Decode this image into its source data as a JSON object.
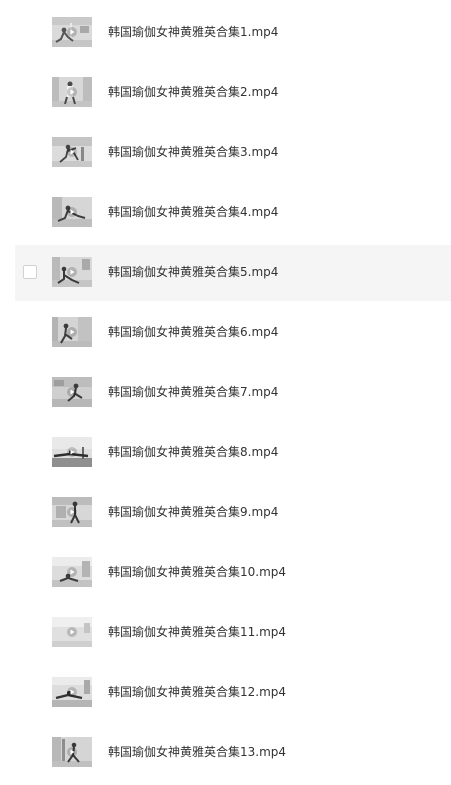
{
  "file_list": {
    "items": [
      {
        "name": "韩国瑜伽女神黄雅英合集1.mp4",
        "icon": "video-thumbnail"
      },
      {
        "name": "韩国瑜伽女神黄雅英合集2.mp4",
        "icon": "video-thumbnail"
      },
      {
        "name": "韩国瑜伽女神黄雅英合集3.mp4",
        "icon": "video-thumbnail"
      },
      {
        "name": "韩国瑜伽女神黄雅英合集4.mp4",
        "icon": "video-thumbnail"
      },
      {
        "name": "韩国瑜伽女神黄雅英合集5.mp4",
        "icon": "video-thumbnail",
        "hovered": true
      },
      {
        "name": "韩国瑜伽女神黄雅英合集6.mp4",
        "icon": "video-thumbnail"
      },
      {
        "name": "韩国瑜伽女神黄雅英合集7.mp4",
        "icon": "video-thumbnail"
      },
      {
        "name": "韩国瑜伽女神黄雅英合集8.mp4",
        "icon": "video-thumbnail"
      },
      {
        "name": "韩国瑜伽女神黄雅英合集9.mp4",
        "icon": "video-thumbnail"
      },
      {
        "name": "韩国瑜伽女神黄雅英合集10.mp4",
        "icon": "video-thumbnail"
      },
      {
        "name": "韩国瑜伽女神黄雅英合集11.mp4",
        "icon": "video-thumbnail"
      },
      {
        "name": "韩国瑜伽女神黄雅英合集12.mp4",
        "icon": "video-thumbnail"
      },
      {
        "name": "韩国瑜伽女神黄雅英合集13.mp4",
        "icon": "video-thumbnail"
      }
    ]
  },
  "colors": {
    "hover_background": "#f5f5f6",
    "text": "#333333"
  }
}
